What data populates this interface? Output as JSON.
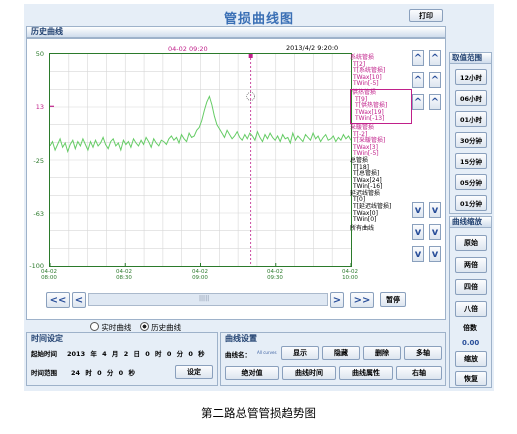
{
  "window": {
    "title": "管损曲线图",
    "print_label": "打印"
  },
  "history_panel": {
    "title": "历史曲线"
  },
  "chart_header": {
    "cursor_time": "04-02 09:20",
    "current_time": "2013/4/2 9:20:0"
  },
  "chart_data": {
    "type": "line",
    "ylim": [
      -100,
      50
    ],
    "y_ticks": [
      "50",
      "13",
      "-25",
      "-63",
      "-100"
    ],
    "y_tick_values": [
      50,
      13,
      -25,
      -63,
      -100
    ],
    "x_ticks": [
      {
        "line1": "04-02",
        "line2": "08:00"
      },
      {
        "line1": "04-02",
        "line2": "08:30"
      },
      {
        "line1": "04-02",
        "line2": "09:00"
      },
      {
        "line1": "04-02",
        "line2": "09:30"
      },
      {
        "line1": "04-02",
        "line2": "10:00"
      }
    ],
    "x_tick_minutes": [
      0,
      30,
      60,
      90,
      120
    ],
    "x_range_minutes": [
      0,
      120
    ],
    "cursor_minute": 80,
    "series": [
      {
        "color": "#66cc66",
        "values": [
          -15,
          -12,
          -18,
          -14,
          -10,
          -16,
          -13,
          -19,
          -14,
          -11,
          -17,
          -12,
          -15,
          -10,
          -14,
          -18,
          -12,
          -16,
          -11,
          -15,
          -13,
          -9,
          -14,
          -17,
          -12,
          -10,
          -15,
          -13,
          -18,
          -11,
          -14,
          -12,
          -16,
          -10,
          -13,
          -15,
          -11,
          -14,
          -9,
          -12,
          -16,
          -10,
          -13,
          -15,
          -11,
          -12,
          -14,
          -10,
          -8,
          -11,
          -9,
          -13,
          -7,
          -10,
          -12,
          -6,
          -9,
          -8,
          -4,
          -2,
          3,
          10,
          16,
          20,
          14,
          6,
          0,
          -3,
          -6,
          -9,
          -4,
          -7,
          -10,
          -8,
          -5,
          -9,
          -11,
          -7,
          -10,
          -6,
          -8,
          -11,
          -5,
          -9,
          -12,
          -7,
          -10,
          -6,
          -9,
          -11,
          -8,
          -12,
          -7,
          -10,
          -9,
          -13,
          -6,
          -11,
          -8,
          -10,
          -12,
          -7,
          -9,
          -11,
          -6,
          -10,
          -8,
          -12,
          -9,
          -7,
          -11,
          -10,
          -8,
          -12,
          -9,
          -11,
          -7,
          -10,
          -8,
          -11
        ]
      }
    ]
  },
  "legend": {
    "groups": [
      {
        "name": "系统管损",
        "color": "#c0208a",
        "lines": [
          "T[2]",
          "T[系统管损]",
          "TWax[10]",
          "TWin[-5]"
        ],
        "boxed": false
      },
      {
        "name": "供热管损",
        "color": "#c0208a",
        "lines": [
          "T[9]",
          "T[供热管损]",
          "TWax[19]",
          "TWin[-13]"
        ],
        "boxed": true
      },
      {
        "name": "采暖管损",
        "color": "#c0208a",
        "lines": [
          "T[-2]",
          "T[采暖管损]",
          "TWax[3]",
          "TWin[-5]"
        ],
        "boxed": false
      },
      {
        "name": "总管损",
        "color": "#000000",
        "lines": [
          "T[18]",
          "T[总管损]",
          "TWax[24]",
          "TWin[-16]"
        ],
        "boxed": false
      },
      {
        "name": "延迟线管损",
        "color": "#000000",
        "lines": [
          "T[0]",
          "T[延迟线管损]",
          "TWax[0]",
          "TWin[0]"
        ],
        "boxed": false
      }
    ],
    "all_curves": "所有曲线"
  },
  "nav": {
    "first": "<<",
    "prev": "<",
    "scroll_grip": "|||||",
    "next": ">",
    "last": ">>",
    "pause": "暂停",
    "up_arrows": [
      "^",
      "^",
      "^",
      "^",
      "^",
      "^"
    ],
    "down_arrows": [
      "v",
      "v",
      "v",
      "v",
      "v",
      "v"
    ]
  },
  "range_panel": {
    "title": "取值范围",
    "options": [
      "12小时",
      "06小时",
      "01小时",
      "30分钟",
      "15分钟",
      "05分钟",
      "01分钟"
    ]
  },
  "zoom_panel": {
    "title": "曲线缩放",
    "buttons": [
      "原始",
      "两倍",
      "四倍",
      "八倍"
    ],
    "factor_label": "倍数",
    "factor_value": "0.00",
    "zoom_button": "缩放",
    "restore_button": "恢复"
  },
  "mode": {
    "realtime": "实时曲线",
    "history": "历史曲线",
    "selected": "history"
  },
  "time_settings": {
    "title": "时间设定",
    "start_label": "起始时间",
    "start": {
      "year": "2013",
      "y_unit": "年",
      "month": "4",
      "m_unit": "月",
      "day": "2",
      "d_unit": "日",
      "hour": "0",
      "h_unit": "时",
      "minute": "0",
      "mi_unit": "分",
      "second": "0",
      "s_unit": "秒"
    },
    "range_label": "时间范围",
    "range": {
      "hours": "24",
      "h_unit": "时",
      "minutes": "0",
      "mi_unit": "分",
      "seconds": "0",
      "s_unit": "秒"
    },
    "set_button": "设定"
  },
  "curve_settings": {
    "title": "曲线设置",
    "name_label": "曲线名：",
    "name_value": "All curves",
    "buttons_row1": [
      "显示",
      "隐藏",
      "删除",
      "多轴"
    ],
    "buttons_row2": [
      "绝对值",
      "曲线时间",
      "曲线属性",
      "右轴"
    ]
  },
  "caption": "第二路总管管损趋势图"
}
